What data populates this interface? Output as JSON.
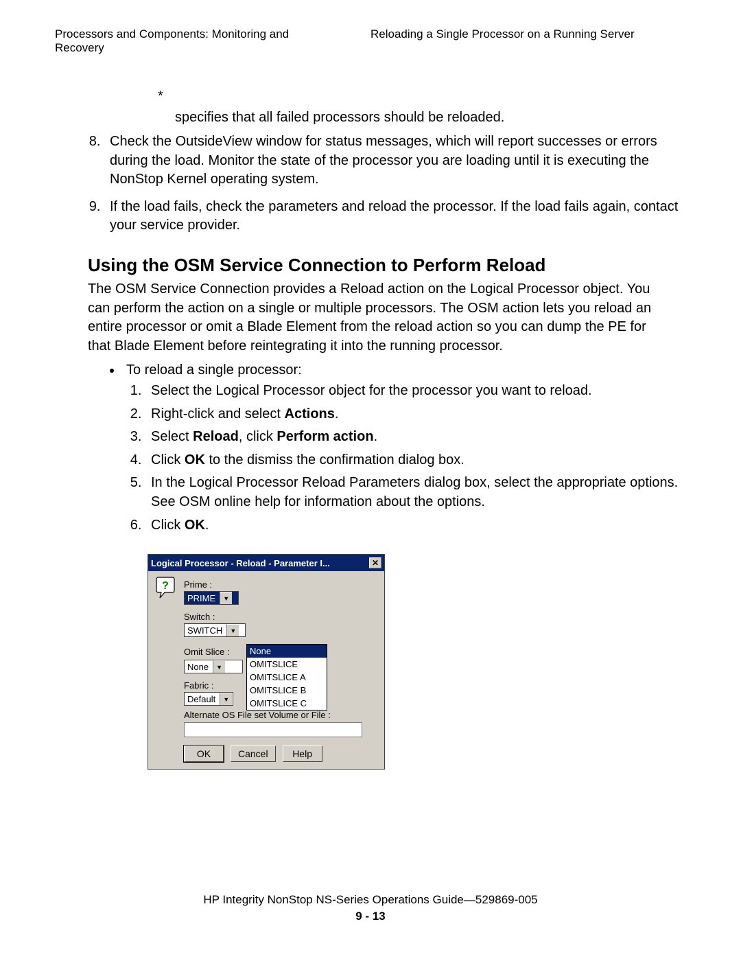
{
  "header": {
    "left": "Processors and Components: Monitoring and Recovery",
    "right": "Reloading a Single Processor on a Running Server"
  },
  "pre": {
    "asterisk": "*",
    "spec": "specifies that all failed processors should be reloaded."
  },
  "steps_cont": {
    "start": 8,
    "items": [
      "Check the OutsideView window for status messages, which will report successes or errors during the load. Monitor the state of the processor you are loading until it is executing the NonStop Kernel operating system.",
      "If the load fails, check the parameters and reload the processor. If the load fails again, contact your service provider."
    ]
  },
  "section_heading": "Using the OSM Service Connection to Perform Reload",
  "section_para": "The OSM Service Connection provides a Reload action on the Logical Processor object. You can perform the action on a single or multiple processors. The OSM action lets you reload an entire processor or omit a Blade Element from the reload action so you can dump the PE for that Blade Element before reintegrating it into the running processor.",
  "bullet_intro": "To reload a single processor:",
  "inner_steps": {
    "s1": "Select the Logical Processor object for the processor you want to reload.",
    "s2_a": "Right-click and select ",
    "s2_b": "Actions",
    "s2_c": ".",
    "s3_a": "Select ",
    "s3_b": "Reload",
    "s3_c": ", click ",
    "s3_d": "Perform action",
    "s3_e": ".",
    "s4_a": "Click ",
    "s4_b": "OK",
    "s4_c": " to the dismiss the confirmation dialog box.",
    "s5": "In the Logical Processor Reload Parameters dialog box, select the appropriate options. See OSM online help for information about the options.",
    "s6_a": "Click ",
    "s6_b": "OK",
    "s6_c": "."
  },
  "dialog": {
    "title": "Logical Processor - Reload - Parameter I...",
    "close": "✕",
    "prime_label": "Prime :",
    "prime_value": "PRIME",
    "switch_label": "Switch :",
    "switch_value": "SWITCH",
    "omit_label": "Omit Slice :",
    "omit_value": "None",
    "omit_options": {
      "o0": "None",
      "o1": "OMITSLICE",
      "o2": "OMITSLICE A",
      "o3": "OMITSLICE B",
      "o4": "OMITSLICE C"
    },
    "fabric_label": "Fabric :",
    "fabric_value": "Default",
    "alt_label": "Alternate OS File set Volume or File :",
    "ok": "OK",
    "cancel": "Cancel",
    "help": "Help"
  },
  "footer": {
    "line": "HP Integrity NonStop NS-Series Operations Guide—529869-005",
    "page": "9 - 13"
  }
}
